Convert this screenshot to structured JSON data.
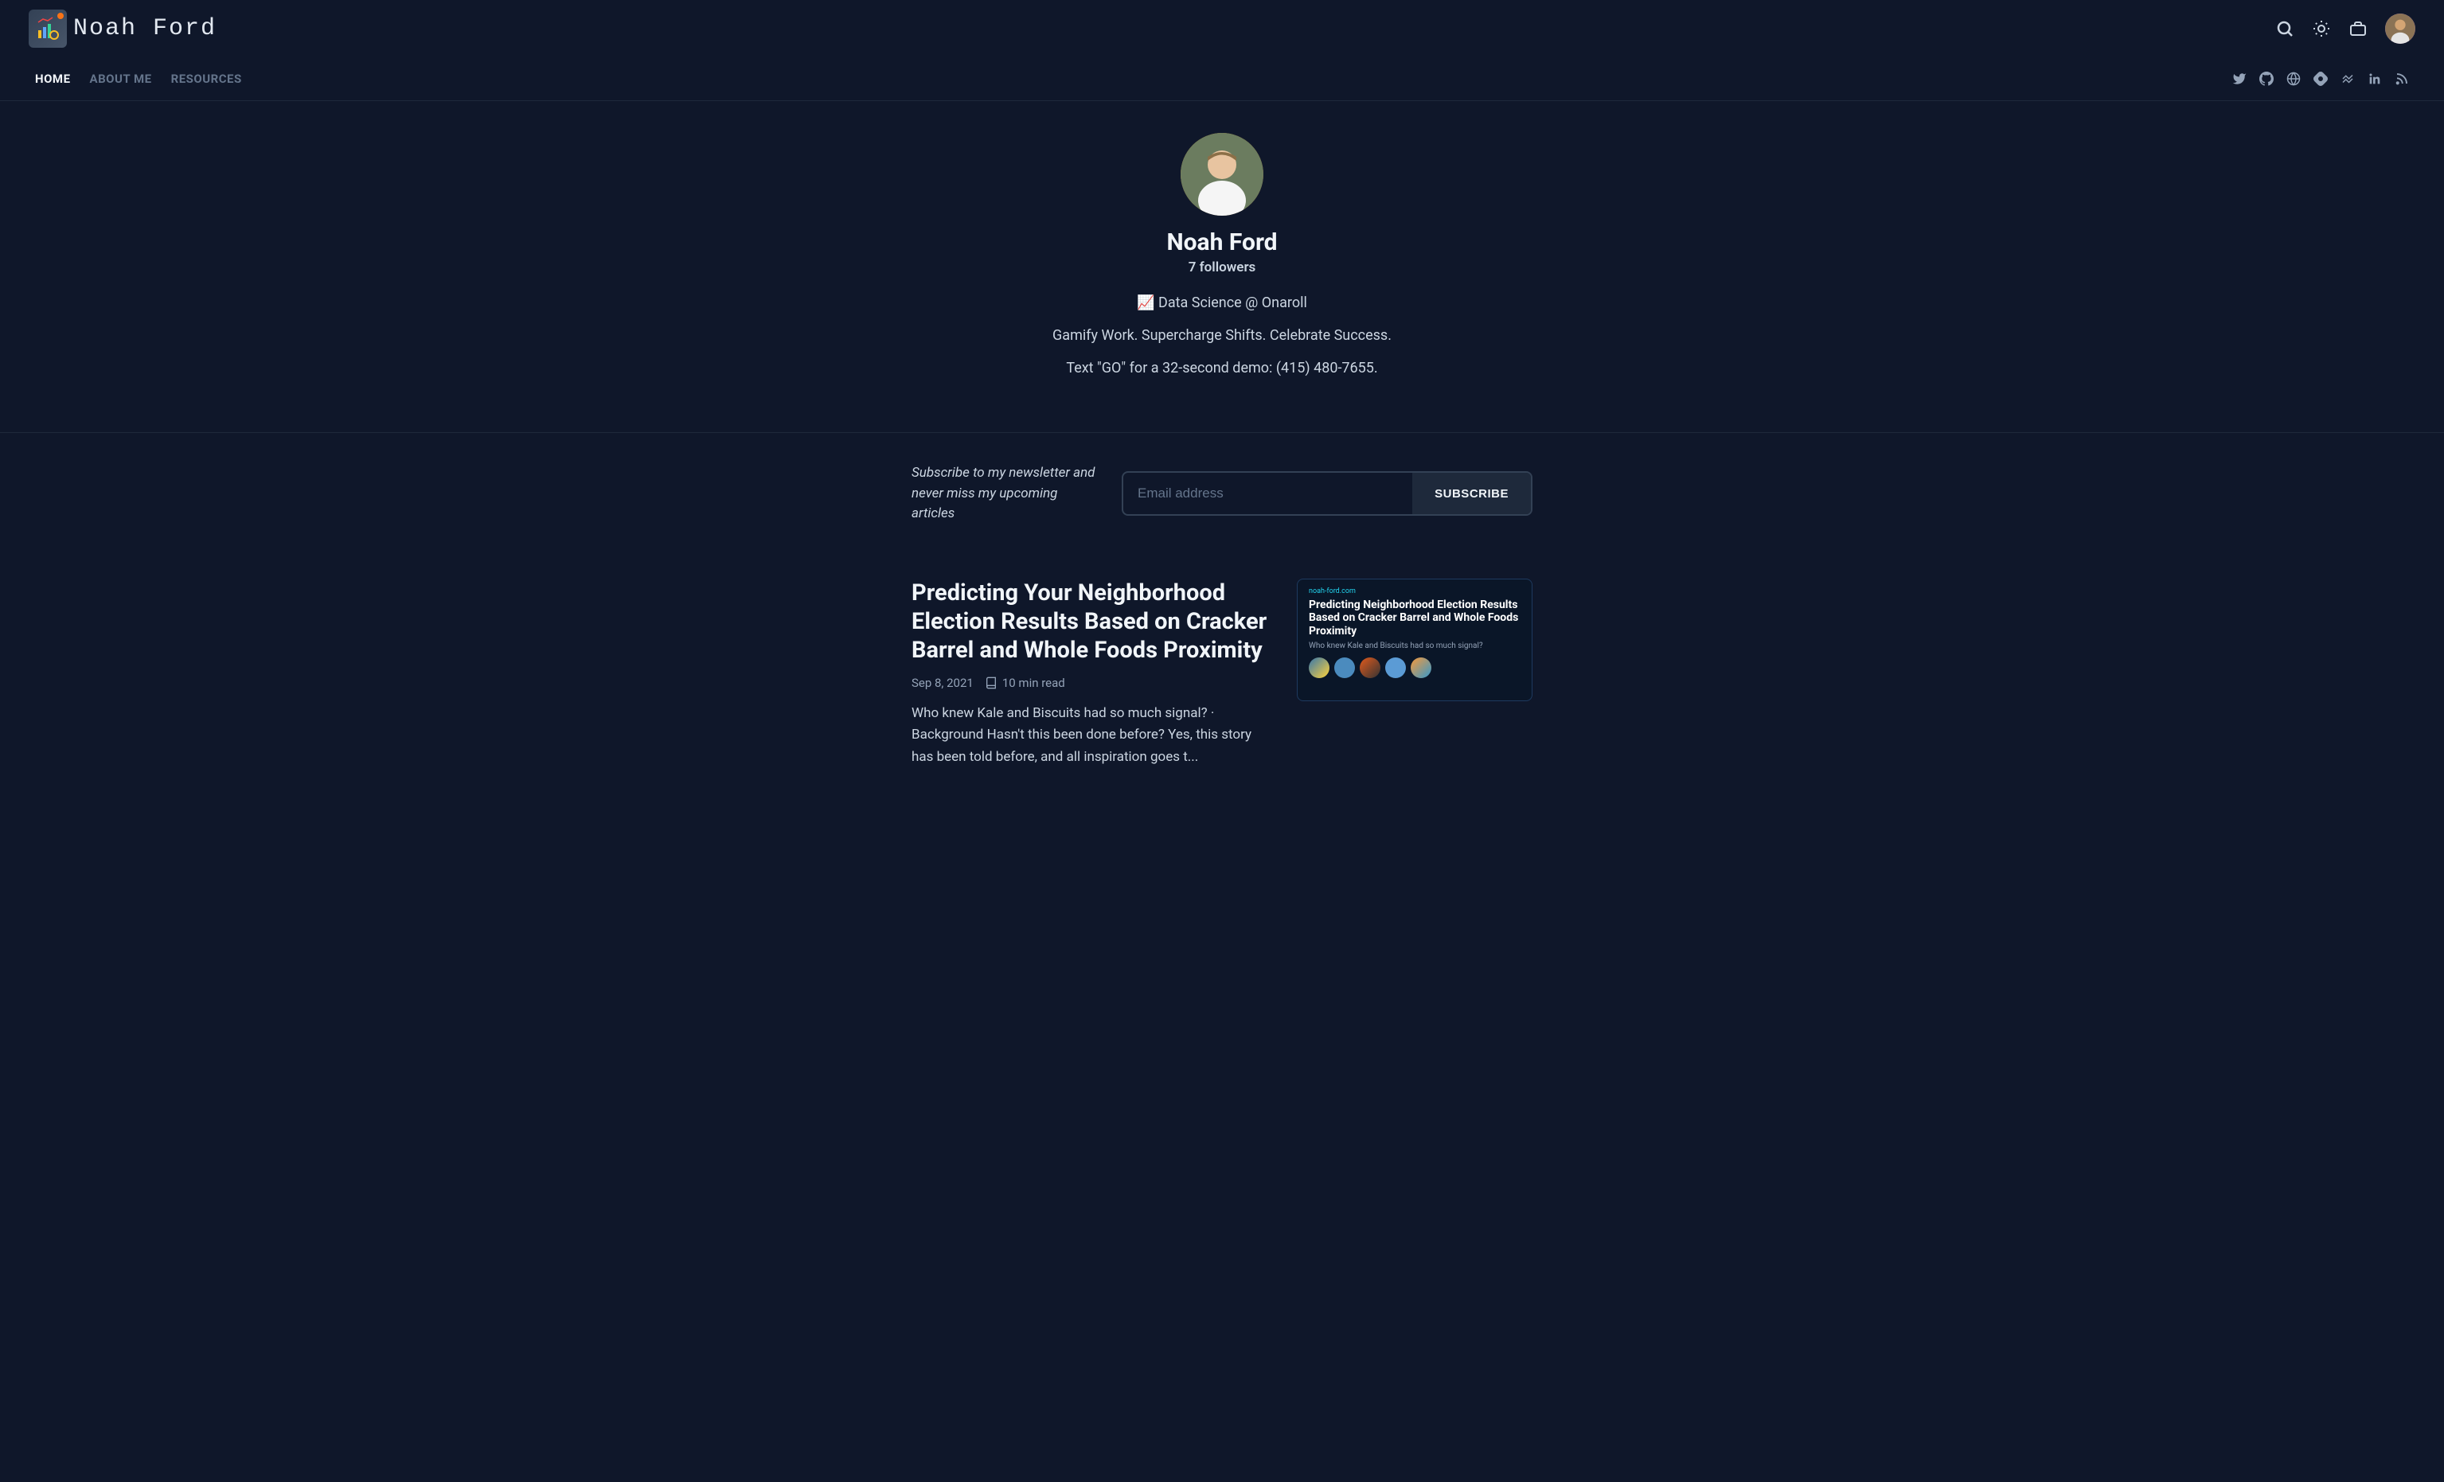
{
  "brand": {
    "name": "Noah Ford"
  },
  "nav": {
    "tabs": [
      {
        "label": "HOME",
        "active": true
      },
      {
        "label": "ABOUT ME",
        "active": false
      },
      {
        "label": "RESOURCES",
        "active": false
      }
    ]
  },
  "hero": {
    "name": "Noah Ford",
    "followers": "7 followers",
    "bio1": "📈 Data Science @ Onaroll",
    "bio2": "Gamify Work. Supercharge Shifts. Celebrate Success.",
    "bio3": "Text \"GO\" for a 32-second demo: (415) 480-7655."
  },
  "newsletter": {
    "text": "Subscribe to my newsletter and never miss my upcoming articles",
    "placeholder": "Email address",
    "button": "SUBSCRIBE"
  },
  "post": {
    "title": "Predicting Your Neighborhood Election Results Based on Cracker Barrel and Whole Foods Proximity",
    "date": "Sep 8, 2021",
    "read_time": "10 min read",
    "excerpt": "Who knew Kale and Biscuits had so much signal? · Background Hasn't this been done before? Yes, this story has been told before, and all inspiration goes t...",
    "thumb": {
      "domain": "noah-ford.com",
      "title": "Predicting Neighborhood Election Results Based on Cracker Barrel and Whole Foods Proximity",
      "subtitle": "Who knew Kale and Biscuits had so much signal?"
    }
  }
}
